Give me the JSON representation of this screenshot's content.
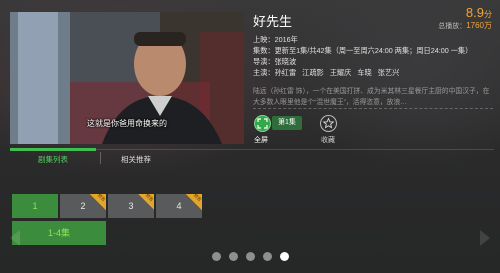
{
  "poster": {
    "subtitle": "这就是你爸用命换来的"
  },
  "detail": {
    "title": "好先生",
    "score_value": "8.9",
    "score_unit": "分",
    "total_label": "总播放：",
    "total_value": "1760万",
    "premiere_label": "上映：",
    "premiere_value": "2016年",
    "episodes_label": "集数：",
    "episodes_value": "更新至1集/共42集（周一至周六24:00 两集；周日24:00 一集）",
    "director_label": "导演：",
    "director_value": "张晓波",
    "cast_label": "主演：",
    "cast": [
      "孙红雷",
      "江疏影",
      "王耀庆",
      "车晓",
      "张艺兴"
    ],
    "description": "陆远（孙红雷 饰），一个在美国打拼、成为米其林三星餐厅主厨的中国汉子，在大多数人眼里他是个“混世魔王”，活得恣意，放浪…"
  },
  "actions": {
    "fullscreen_label": "全屏",
    "episode_badge": "第1集",
    "favorite_label": "收藏"
  },
  "tabs": [
    {
      "label": "剧集列表",
      "active": true
    },
    {
      "label": "相关推荐",
      "active": false
    }
  ],
  "episodes": [
    {
      "label": "1",
      "selected": true,
      "badge": ""
    },
    {
      "label": "2",
      "selected": false,
      "badge": "预告"
    },
    {
      "label": "3",
      "selected": false,
      "badge": "预告"
    },
    {
      "label": "4",
      "selected": false,
      "badge": "预告"
    }
  ],
  "episode_range": "1-4集",
  "pagination": {
    "count": 5,
    "active_index": 4
  },
  "colors": {
    "accent_green": "#3fbf4f",
    "score_orange": "#f2a43a",
    "badge_gold": "#e3a52b"
  }
}
